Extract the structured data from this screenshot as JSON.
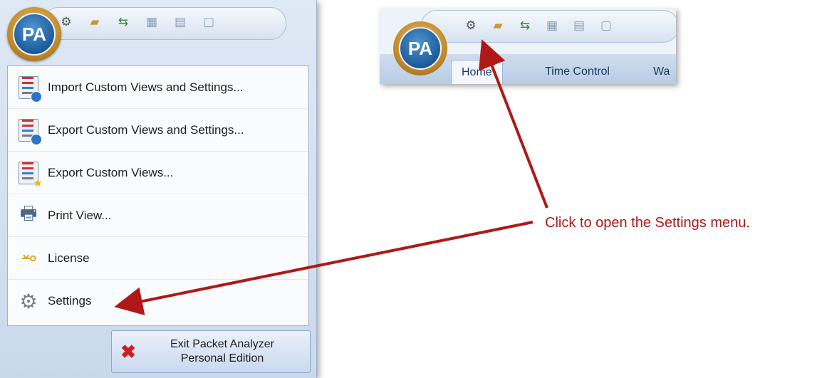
{
  "app_menu": {
    "logo_text": "PA",
    "quick_access_icons": [
      "gear-icon",
      "folder-icon",
      "flow-icon",
      "grid-icon",
      "save-icon",
      "export-icon"
    ],
    "items": [
      {
        "label": "Import Custom Views and Settings...",
        "icon": "import-views-icon"
      },
      {
        "label": "Export Custom Views and Settings...",
        "icon": "export-views-icon"
      },
      {
        "label": "Export Custom Views...",
        "icon": "export-custom-views-icon"
      },
      {
        "label": "Print View...",
        "icon": "printer-icon"
      },
      {
        "label": "License",
        "icon": "key-icon"
      },
      {
        "label": "Settings",
        "icon": "gear-icon"
      }
    ],
    "exit_button": {
      "line1": "Exit Packet Analyzer",
      "line2": "Personal Edition",
      "icon": "close-x-icon"
    }
  },
  "inset": {
    "logo_text": "PA",
    "tabs": [
      "Home",
      "Time Control",
      "Wa"
    ]
  },
  "callout": {
    "text": "Click to open the Settings menu.",
    "color": "#b01818"
  }
}
